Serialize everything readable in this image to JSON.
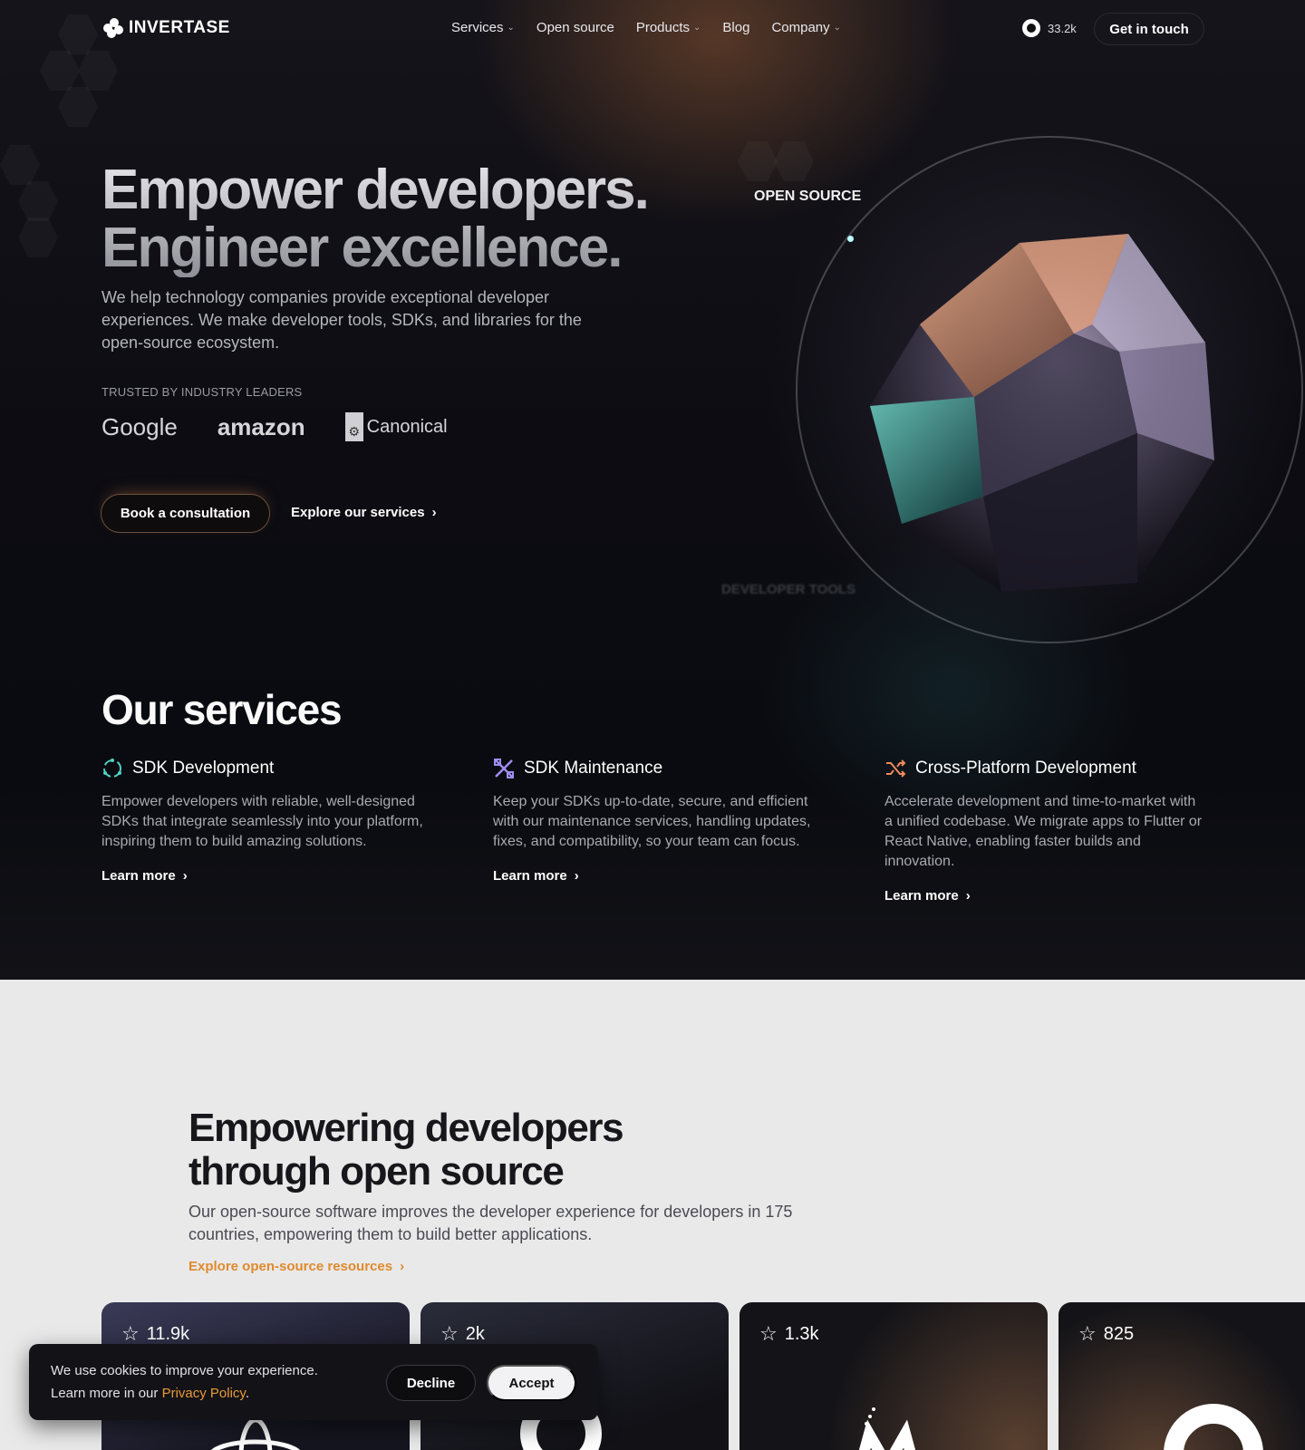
{
  "nav": {
    "brand": "INVERTASE",
    "links": [
      {
        "label": "Services",
        "has_menu": true
      },
      {
        "label": "Open source",
        "has_menu": false
      },
      {
        "label": "Products",
        "has_menu": true
      },
      {
        "label": "Blog",
        "has_menu": false
      },
      {
        "label": "Company",
        "has_menu": true
      }
    ],
    "github_stars": "33.2k",
    "cta": "Get in touch"
  },
  "hero": {
    "title_line1": "Empower developers.",
    "title_line2": "Engineer excellence.",
    "subtitle": "We help technology companies provide exceptional developer experiences. We make developer tools, SDKs, and libraries for the open-source ecosystem.",
    "trusted_label": "TRUSTED BY INDUSTRY LEADERS",
    "trusted_logos": [
      "Google",
      "amazon",
      "Canonical"
    ],
    "primary_button": "Book a consultation",
    "secondary_link": "Explore our services",
    "orb_label_top": "OPEN SOURCE",
    "orb_label_bottom": "DEVELOPER TOOLS"
  },
  "services": {
    "title": "Our services",
    "items": [
      {
        "title": "SDK Development",
        "description": "Empower developers with reliable, well-designed SDKs that integrate seamlessly into your platform, inspiring them to build amazing solutions.",
        "link": "Learn more",
        "icon": "cycle-icon",
        "color": "#4fd1c5"
      },
      {
        "title": "SDK Maintenance",
        "description": "Keep your SDKs up-to-date, secure, and efficient with our maintenance services, handling updates, fixes, and compatibility, so your team can focus.",
        "link": "Learn more",
        "icon": "tools-icon",
        "color": "#9f8cf0"
      },
      {
        "title": "Cross-Platform Development",
        "description": "Accelerate development and time-to-market with a unified codebase. We migrate apps to Flutter or React Native, enabling faster builds and innovation.",
        "link": "Learn more",
        "icon": "shuffle-icon",
        "color": "#f08a5d"
      }
    ]
  },
  "open_source": {
    "title_line1": "Empowering developers",
    "title_line2": "through open source",
    "subtitle": "Our open-source software improves the developer experience for developers in 175 countries, empowering them to build better applications.",
    "link": "Explore open-source resources",
    "cards": [
      {
        "stars": "11.9k"
      },
      {
        "stars": "2k"
      },
      {
        "stars": "1.3k"
      },
      {
        "stars": "825"
      }
    ]
  },
  "cookie": {
    "line1": "We use cookies to improve your experience.",
    "line2_prefix": "Learn more in our ",
    "policy_link": "Privacy Policy",
    "line2_suffix": ".",
    "decline": "Decline",
    "accept": "Accept"
  },
  "colors": {
    "accent_orange": "#e08a2c",
    "hero_bg": "#0c0c12",
    "section_light_bg": "#e9e9ea"
  }
}
